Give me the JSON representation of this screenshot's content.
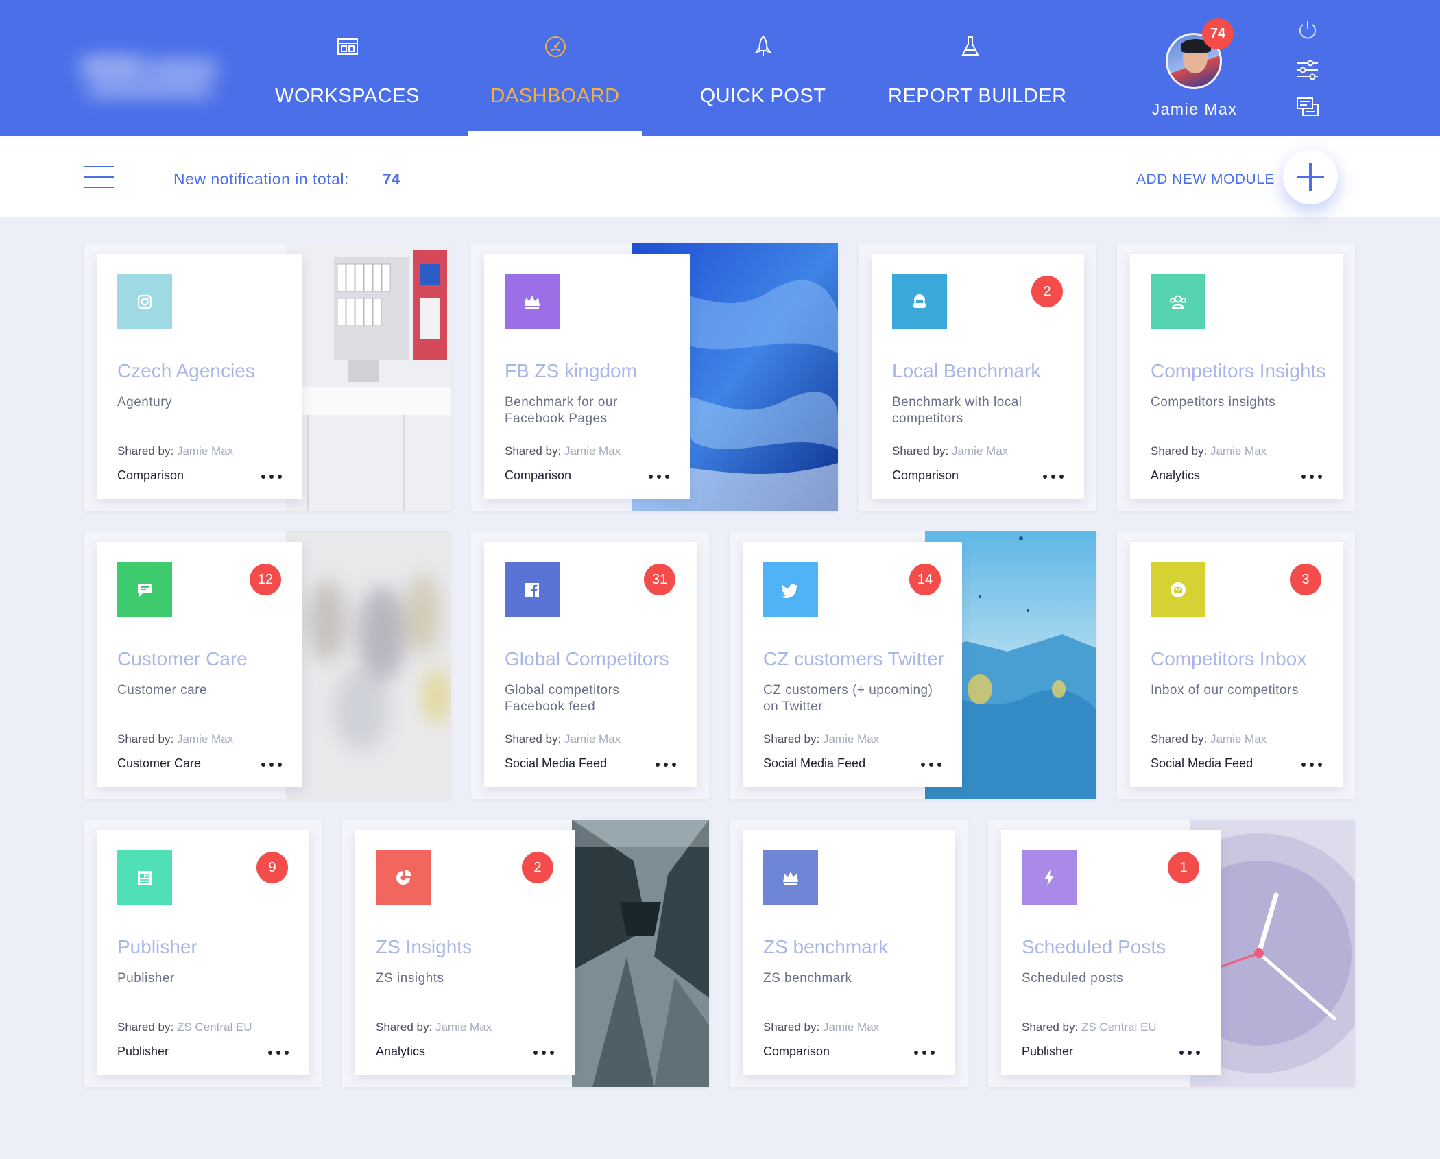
{
  "nav": {
    "items": [
      {
        "label": "WORKSPACES",
        "icon": "workspaces-icon"
      },
      {
        "label": "DASHBOARD",
        "icon": "dashboard-gauge-icon",
        "active": true
      },
      {
        "label": "QUICK POST",
        "icon": "rocket-icon"
      },
      {
        "label": "REPORT BUILDER",
        "icon": "flask-icon"
      }
    ],
    "active_color": "#f5b13b",
    "bar_color": "#4a6fe8"
  },
  "user": {
    "name": "Jamie Max",
    "notifications": "74",
    "icons": [
      "power-icon",
      "sliders-icon",
      "chat-icon"
    ]
  },
  "subbar": {
    "notification_label": "New notification in total:",
    "notification_count": "74",
    "add_module_label": "ADD NEW MODULE",
    "add_icon": "plus-icon"
  },
  "modules": [
    {
      "title": "Czech Agencies",
      "desc": "Agentury",
      "shared_by": "Jamie Max",
      "type": "Comparison",
      "badge": "",
      "icon": "instagram-icon",
      "color": "#9fd9e3",
      "bg": "office"
    },
    {
      "title": "FB ZS kingdom",
      "desc": "Benchmark for our Facebook Pages",
      "shared_by": "Jamie Max",
      "type": "Comparison",
      "badge": "",
      "icon": "crown-icon",
      "color": "#9b6fe6",
      "bg": "ocean"
    },
    {
      "title": "Local Benchmark",
      "desc": "Benchmark with local competitors",
      "shared_by": "Jamie Max",
      "type": "Comparison",
      "badge": "2",
      "icon": "armchair-icon",
      "color": "#3aa8d8",
      "bg": ""
    },
    {
      "title": "Competitors Insights",
      "desc": "Competitors insights",
      "shared_by": "Jamie Max",
      "type": "Analytics",
      "badge": "",
      "icon": "group-icon",
      "color": "#56d3b0",
      "bg": ""
    },
    {
      "title": "Customer Care",
      "desc": "Customer care",
      "shared_by": "Jamie Max",
      "type": "Customer Care",
      "badge": "12",
      "icon": "chat-bubble-icon",
      "color": "#3ecb6e",
      "bg": "blur"
    },
    {
      "title": "Global Competitors",
      "desc": "Global competitors Facebook feed",
      "shared_by": "Jamie Max",
      "type": "Social Media Feed",
      "badge": "31",
      "icon": "facebook-icon",
      "color": "#5a74d6",
      "bg": ""
    },
    {
      "title": "CZ customers Twitter",
      "desc": "CZ customers (+ upcoming) on Twitter",
      "shared_by": "Jamie Max",
      "type": "Social Media Feed",
      "badge": "14",
      "icon": "twitter-icon",
      "color": "#4fb3f6",
      "bg": "balloons"
    },
    {
      "title": "Competitors Inbox",
      "desc": "Inbox of our competitors",
      "shared_by": "Jamie Max",
      "type": "Social Media Feed",
      "badge": "3",
      "icon": "mail-icon",
      "color": "#d6d234",
      "bg": ""
    },
    {
      "title": "Publisher",
      "desc": "Publisher",
      "shared_by": "ZS Central EU",
      "type": "Publisher",
      "badge": "9",
      "icon": "newspaper-icon",
      "color": "#4fe0b8",
      "bg": ""
    },
    {
      "title": "ZS Insights",
      "desc": "ZS insights",
      "shared_by": "Jamie Max",
      "type": "Analytics",
      "badge": "2",
      "icon": "pie-chart-icon",
      "color": "#f2665f",
      "bg": "buildings"
    },
    {
      "title": "ZS benchmark",
      "desc": "ZS benchmark",
      "shared_by": "Jamie Max",
      "type": "Comparison",
      "badge": "",
      "icon": "crown-icon",
      "color": "#6f86d6",
      "bg": ""
    },
    {
      "title": "Scheduled Posts",
      "desc": "Scheduled posts",
      "shared_by": "ZS Central EU",
      "type": "Publisher",
      "badge": "1",
      "icon": "lightning-icon",
      "color": "#a98ae8",
      "bg": "clock"
    }
  ],
  "labels": {
    "shared_prefix": "Shared by:"
  }
}
